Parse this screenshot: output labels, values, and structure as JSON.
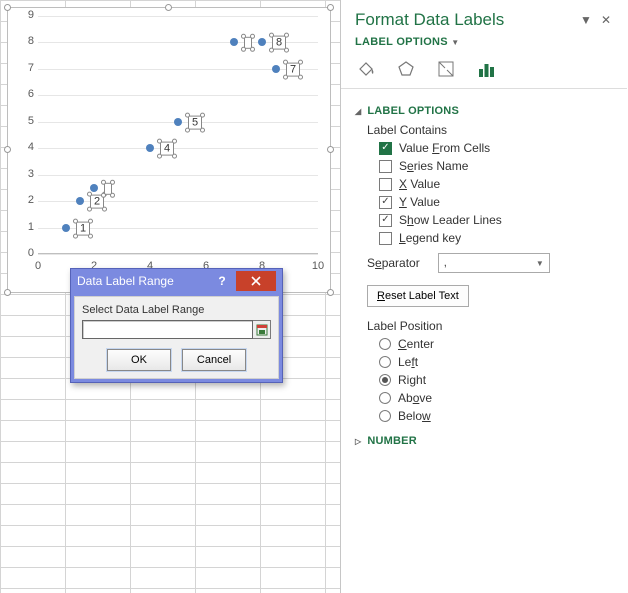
{
  "chart_data": {
    "type": "scatter",
    "x": [
      1,
      1.5,
      2,
      4,
      5,
      7,
      8,
      8.5
    ],
    "y": [
      1,
      2,
      2.5,
      4,
      5,
      8,
      8,
      7
    ],
    "labels": [
      "1",
      "2",
      "",
      "4",
      "5",
      "",
      "8",
      "7"
    ],
    "xlim": [
      0,
      10
    ],
    "ylim": [
      0,
      9
    ],
    "xticks": [
      0,
      2,
      4,
      6,
      8,
      10
    ],
    "yticks": [
      0,
      1,
      2,
      3,
      4,
      5,
      6,
      7,
      8,
      9
    ],
    "xlabel": "",
    "ylabel": "",
    "title": ""
  },
  "dialog": {
    "title": "Data Label Range",
    "label": "Select Data Label Range",
    "value": "",
    "ok": "OK",
    "cancel": "Cancel"
  },
  "pane": {
    "title": "Format Data Labels",
    "subtitle": "LABEL OPTIONS",
    "section_label_options": "LABEL OPTIONS",
    "label_contains": "Label Contains",
    "opts": {
      "value_from_cells_pre": "Value ",
      "value_from_cells_u": "F",
      "value_from_cells_post": "rom Cells",
      "series_name_pre": "S",
      "series_name_u": "e",
      "series_name_post": "ries Name",
      "x_value_u": "X",
      "x_value_post": " Value",
      "y_value_u": "Y",
      "y_value_post": " Value",
      "leader_pre": "S",
      "leader_u": "h",
      "leader_post": "ow Leader Lines",
      "legend_pre": "",
      "legend_u": "L",
      "legend_post": "egend key"
    },
    "separator_label": "Separator",
    "separator": {
      "pre": "S",
      "u": "e",
      "post": "parator"
    },
    "separator_value": ",",
    "reset": {
      "u": "R",
      "post": "eset Label Text"
    },
    "label_position": "Label Position",
    "pos": {
      "center": {
        "pre": "",
        "u": "C",
        "post": "enter"
      },
      "left": {
        "pre": "Le",
        "u": "f",
        "post": "t"
      },
      "right": {
        "pre": "Ri",
        "u": "g",
        "post": "ht"
      },
      "above": {
        "pre": "Ab",
        "u": "o",
        "post": "ve"
      },
      "below": {
        "pre": "Belo",
        "u": "w",
        "post": ""
      }
    },
    "section_number": "NUMBER"
  }
}
